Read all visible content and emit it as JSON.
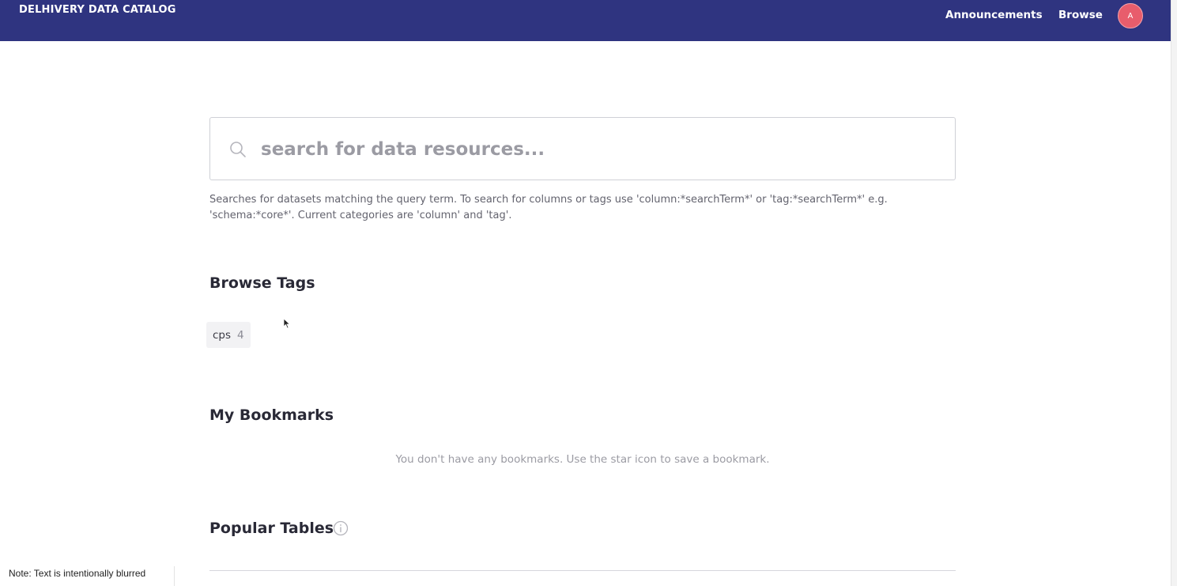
{
  "nav": {
    "brand": "DELHIVERY DATA CATALOG",
    "links": [
      "Announcements",
      "Browse"
    ],
    "avatar_initial": "A",
    "bg_color": "#2f3480",
    "avatar_color": "#e85d6c"
  },
  "search": {
    "placeholder": "search for data resources...",
    "value": "",
    "icon": "search-icon",
    "help_text": "Searches for datasets matching the query term. To search for columns or tags use 'column:*searchTerm*' or 'tag:*searchTerm*' e.g. 'schema:*core*'. Current categories are 'column' and 'tag'."
  },
  "browse_tags": {
    "title": "Browse Tags",
    "tags": [
      {
        "name": "cps",
        "count": "4"
      }
    ]
  },
  "bookmarks": {
    "title": "My Bookmarks",
    "empty_message": "You don't have any bookmarks. Use the star icon to save a bookmark."
  },
  "popular_tables": {
    "title": "Popular Tables",
    "info_icon": "info-icon"
  },
  "footer_note": "Note: Text is intentionally blurred"
}
